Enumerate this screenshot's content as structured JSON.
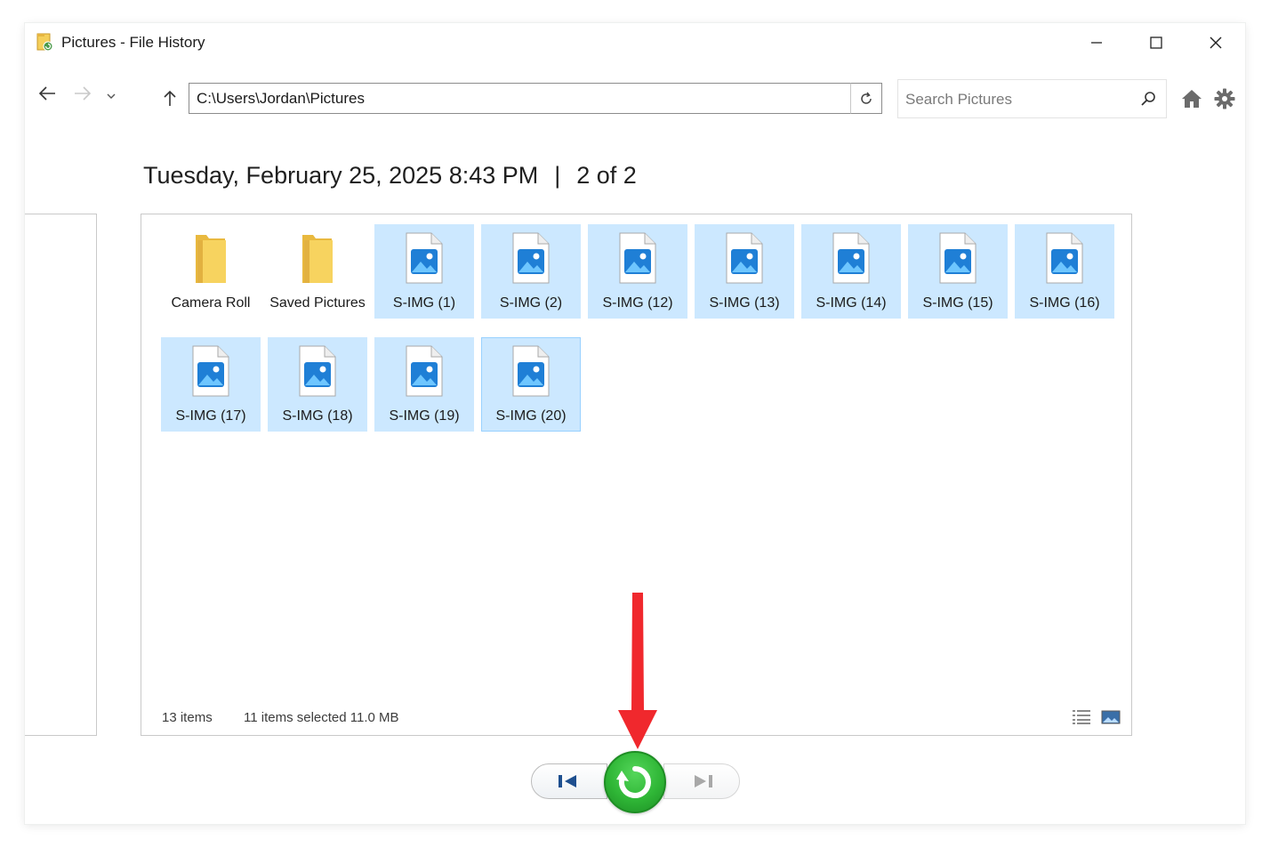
{
  "window": {
    "title": "Pictures - File History"
  },
  "navigation": {
    "back_icon": "arrow-left-icon",
    "forward_icon": "arrow-right-icon",
    "recent_icon": "chevron-down-icon",
    "up_icon": "arrow-up-icon"
  },
  "address_bar": {
    "path": "C:\\Users\\Jordan\\Pictures"
  },
  "search": {
    "placeholder": "Search Pictures"
  },
  "snapshot": {
    "date": "Tuesday, February 25, 2025 8:43 PM",
    "separator": "|",
    "position": "2 of 2"
  },
  "items": [
    {
      "label": "Camera Roll",
      "type": "folder",
      "selected": false
    },
    {
      "label": "Saved Pictures",
      "type": "folder",
      "selected": false
    },
    {
      "label": "S-IMG (1)",
      "type": "image",
      "selected": true
    },
    {
      "label": "S-IMG (2)",
      "type": "image",
      "selected": true
    },
    {
      "label": "S-IMG (12)",
      "type": "image",
      "selected": true
    },
    {
      "label": "S-IMG (13)",
      "type": "image",
      "selected": true
    },
    {
      "label": "S-IMG (14)",
      "type": "image",
      "selected": true
    },
    {
      "label": "S-IMG (15)",
      "type": "image",
      "selected": true
    },
    {
      "label": "S-IMG (16)",
      "type": "image",
      "selected": true
    },
    {
      "label": "S-IMG (17)",
      "type": "image",
      "selected": true
    },
    {
      "label": "S-IMG (18)",
      "type": "image",
      "selected": true
    },
    {
      "label": "S-IMG (19)",
      "type": "image",
      "selected": true
    },
    {
      "label": "S-IMG (20)",
      "type": "image",
      "selected": true
    }
  ],
  "status": {
    "item_count": "13 items",
    "selection": "11 items selected  11.0 MB"
  },
  "playback": {
    "previous_icon": "skip-previous-icon",
    "restore_icon": "restore-icon",
    "next_icon": "skip-next-icon"
  },
  "colors": {
    "selection": "#cce8ff",
    "restore_green": "#2fb636",
    "annotation_red": "#f0282d",
    "folder_yellow": "#f5cf5a",
    "image_blue": "#1f7fd6"
  }
}
